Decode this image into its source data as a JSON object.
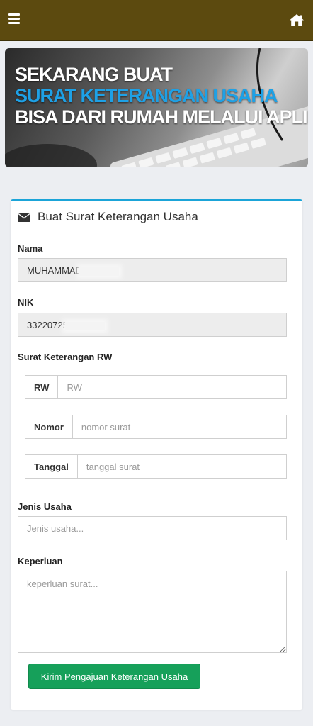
{
  "header": {
    "menu_icon": "hamburger-icon",
    "home_icon": "home-icon",
    "bar_color": "#5c4a0f"
  },
  "banner": {
    "line1": "SEKARANG BUAT",
    "line2": "SURAT KETERANGAN USAHA",
    "line3": "BISA DARI RUMAH MELALUI APLIKASI"
  },
  "form": {
    "title": "Buat Surat Keterangan Usaha",
    "title_icon": "envelope-icon",
    "nama": {
      "label": "Nama",
      "value": "MUHAMMAD"
    },
    "nik": {
      "label": "NIK",
      "value": "33220725"
    },
    "surat_rw": {
      "label": "Surat Keterangan RW",
      "rw": {
        "addon": "RW",
        "placeholder": "RW"
      },
      "nomor": {
        "addon": "Nomor",
        "placeholder": "nomor surat"
      },
      "tanggal": {
        "addon": "Tanggal",
        "placeholder": "tanggal surat"
      }
    },
    "jenis_usaha": {
      "label": "Jenis Usaha",
      "placeholder": "Jenis usaha..."
    },
    "keperluan": {
      "label": "Keperluan",
      "placeholder": "keperluan surat..."
    },
    "submit_label": "Kirim Pengajuan Keterangan Usaha",
    "accent_color": "#1ba4d8",
    "button_color": "#16a05a"
  }
}
